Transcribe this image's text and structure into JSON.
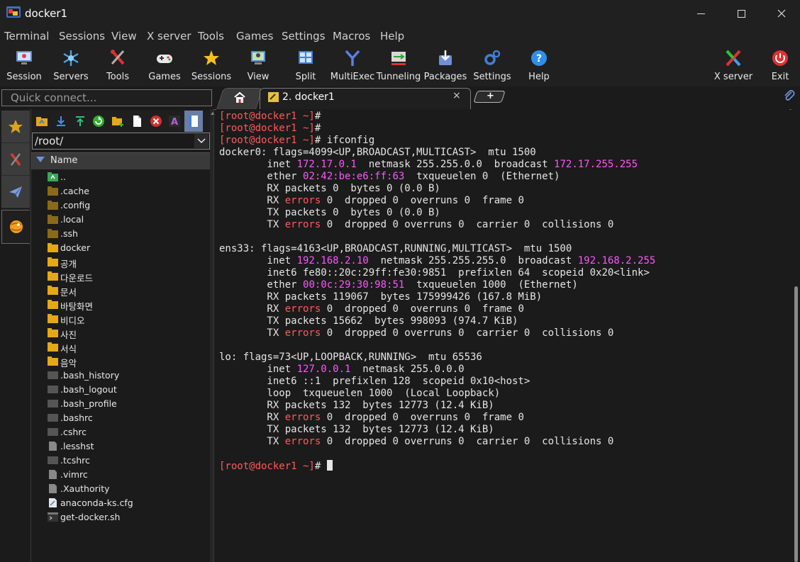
{
  "window": {
    "title": "docker1"
  },
  "menu": [
    "Terminal",
    "Sessions",
    "View",
    "X server",
    "Tools",
    "Games",
    "Settings",
    "Macros",
    "Help"
  ],
  "toolbar": {
    "left": [
      {
        "label": "Session",
        "icon": "session-icon"
      },
      {
        "label": "Servers",
        "icon": "servers-icon"
      },
      {
        "label": "Tools",
        "icon": "tools-icon"
      },
      {
        "label": "Games",
        "icon": "games-icon"
      },
      {
        "label": "Sessions",
        "icon": "sessions-star-icon"
      },
      {
        "label": "View",
        "icon": "view-icon"
      },
      {
        "label": "Split",
        "icon": "split-icon"
      },
      {
        "label": "MultiExec",
        "icon": "multiexec-icon"
      },
      {
        "label": "Tunneling",
        "icon": "tunneling-icon"
      },
      {
        "label": "Packages",
        "icon": "packages-icon"
      },
      {
        "label": "Settings",
        "icon": "settings-gears-icon"
      },
      {
        "label": "Help",
        "icon": "help-icon"
      }
    ],
    "right": [
      {
        "label": "X server",
        "icon": "x-server-icon"
      },
      {
        "label": "Exit",
        "icon": "exit-power-icon"
      }
    ]
  },
  "quick_connect": {
    "placeholder": "Quick connect..."
  },
  "tabs": {
    "active_label": "2. docker1",
    "close": "×",
    "new_tab": "+"
  },
  "file_browser": {
    "path": "/root/",
    "column": "Name",
    "items": [
      {
        "name": "..",
        "type": "up"
      },
      {
        "name": ".cache",
        "type": "hidden-folder"
      },
      {
        "name": ".config",
        "type": "hidden-folder"
      },
      {
        "name": ".local",
        "type": "hidden-folder"
      },
      {
        "name": ".ssh",
        "type": "hidden-folder"
      },
      {
        "name": "docker",
        "type": "folder"
      },
      {
        "name": "공개",
        "type": "folder"
      },
      {
        "name": "다운로드",
        "type": "folder"
      },
      {
        "name": "문서",
        "type": "folder"
      },
      {
        "name": "바탕화면",
        "type": "folder"
      },
      {
        "name": "비디오",
        "type": "folder"
      },
      {
        "name": "사진",
        "type": "folder"
      },
      {
        "name": "서식",
        "type": "folder"
      },
      {
        "name": "음악",
        "type": "folder"
      },
      {
        "name": ".bash_history",
        "type": "hidden-file"
      },
      {
        "name": ".bash_logout",
        "type": "hidden-file"
      },
      {
        "name": ".bash_profile",
        "type": "hidden-file"
      },
      {
        "name": ".bashrc",
        "type": "hidden-file"
      },
      {
        "name": ".cshrc",
        "type": "hidden-file"
      },
      {
        "name": ".lesshst",
        "type": "text-file"
      },
      {
        "name": ".tcshrc",
        "type": "hidden-file"
      },
      {
        "name": ".vimrc",
        "type": "text-file"
      },
      {
        "name": ".Xauthority",
        "type": "text-file"
      },
      {
        "name": "anaconda-ks.cfg",
        "type": "cfg-file"
      },
      {
        "name": "get-docker.sh",
        "type": "script-file"
      }
    ]
  },
  "terminal": {
    "lines": [
      [
        {
          "t": "[root@docker1 ~]",
          "c": "prompt"
        },
        {
          "t": "#"
        }
      ],
      [
        {
          "t": "[root@docker1 ~]",
          "c": "prompt"
        },
        {
          "t": "#"
        }
      ],
      [
        {
          "t": "[root@docker1 ~]",
          "c": "prompt"
        },
        {
          "t": "# ifconfig"
        }
      ],
      [
        {
          "t": "docker0: flags=4099<UP,BROADCAST,MULTICAST>  mtu 1500"
        }
      ],
      [
        {
          "t": "        inet "
        },
        {
          "t": "172.17.0.1",
          "c": "ip"
        },
        {
          "t": "  netmask 255.255.0.0  broadcast "
        },
        {
          "t": "172.17.255.255",
          "c": "ip"
        }
      ],
      [
        {
          "t": "        ether "
        },
        {
          "t": "02:42:be:e6:ff:63",
          "c": "ip"
        },
        {
          "t": "  txqueuelen 0  (Ethernet)"
        }
      ],
      [
        {
          "t": "        RX packets 0  bytes 0 (0.0 B)"
        }
      ],
      [
        {
          "t": "        RX "
        },
        {
          "t": "errors",
          "c": "err"
        },
        {
          "t": " 0  dropped 0  overruns 0  frame 0"
        }
      ],
      [
        {
          "t": "        TX packets 0  bytes 0 (0.0 B)"
        }
      ],
      [
        {
          "t": "        TX "
        },
        {
          "t": "errors",
          "c": "err"
        },
        {
          "t": " 0  dropped 0 overruns 0  carrier 0  collisions 0"
        }
      ],
      [
        {
          "t": ""
        }
      ],
      [
        {
          "t": "ens33: flags=4163<UP,BROADCAST,RUNNING,MULTICAST>  mtu 1500"
        }
      ],
      [
        {
          "t": "        inet "
        },
        {
          "t": "192.168.2.10",
          "c": "ip"
        },
        {
          "t": "  netmask 255.255.255.0  broadcast "
        },
        {
          "t": "192.168.2.255",
          "c": "ip"
        }
      ],
      [
        {
          "t": "        inet6 fe80::20c:29ff:fe30:9851  prefixlen 64  scopeid 0x20<link>"
        }
      ],
      [
        {
          "t": "        ether "
        },
        {
          "t": "00:0c:29:30:98:51",
          "c": "ip"
        },
        {
          "t": "  txqueuelen 1000  (Ethernet)"
        }
      ],
      [
        {
          "t": "        RX packets 119067  bytes 175999426 (167.8 MiB)"
        }
      ],
      [
        {
          "t": "        RX "
        },
        {
          "t": "errors",
          "c": "err"
        },
        {
          "t": " 0  dropped 0  overruns 0  frame 0"
        }
      ],
      [
        {
          "t": "        TX packets 15662  bytes 998093 (974.7 KiB)"
        }
      ],
      [
        {
          "t": "        TX "
        },
        {
          "t": "errors",
          "c": "err"
        },
        {
          "t": " 0  dropped 0 overruns 0  carrier 0  collisions 0"
        }
      ],
      [
        {
          "t": ""
        }
      ],
      [
        {
          "t": "lo: flags=73<UP,LOOPBACK,RUNNING>  mtu 65536"
        }
      ],
      [
        {
          "t": "        inet "
        },
        {
          "t": "127.0.0.1",
          "c": "ip"
        },
        {
          "t": "  netmask 255.0.0.0"
        }
      ],
      [
        {
          "t": "        inet6 ::1  prefixlen 128  scopeid 0x10<host>"
        }
      ],
      [
        {
          "t": "        loop  txqueuelen 1000  (Local Loopback)"
        }
      ],
      [
        {
          "t": "        RX packets 132  bytes 12773 (12.4 KiB)"
        }
      ],
      [
        {
          "t": "        RX "
        },
        {
          "t": "errors",
          "c": "err"
        },
        {
          "t": " 0  dropped 0  overruns 0  frame 0"
        }
      ],
      [
        {
          "t": "        TX packets 132  bytes 12773 (12.4 KiB)"
        }
      ],
      [
        {
          "t": "        TX "
        },
        {
          "t": "errors",
          "c": "err"
        },
        {
          "t": " 0  dropped 0 overruns 0  carrier 0  collisions 0"
        }
      ],
      [
        {
          "t": ""
        }
      ],
      [
        {
          "t": "[root@docker1 ~]",
          "c": "prompt"
        },
        {
          "t": "# "
        }
      ]
    ]
  },
  "colors": {
    "prompt": "#ff5a5a",
    "ip": "#ff55ff",
    "error": "#ff5a5a",
    "folder": "#e6a817",
    "accent": "#6f8fd8"
  }
}
